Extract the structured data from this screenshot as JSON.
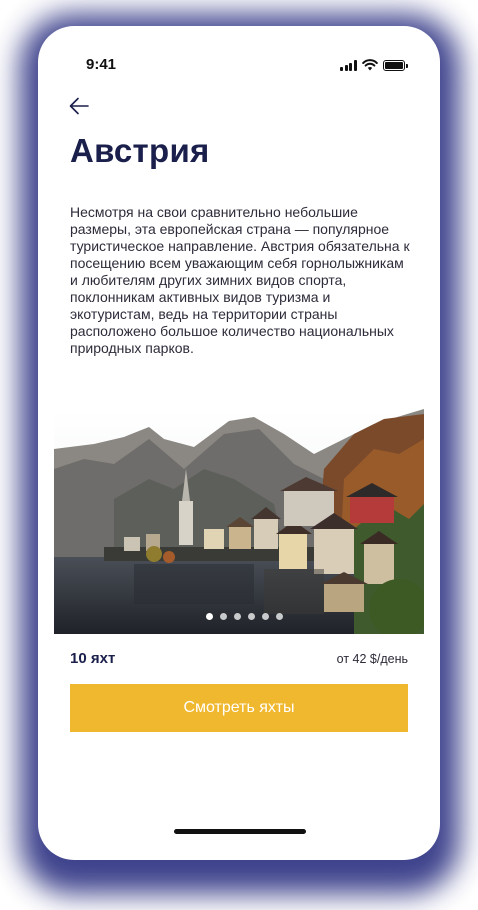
{
  "status_bar": {
    "time": "9:41",
    "icons": [
      "signal-icon",
      "wifi-icon",
      "battery-icon"
    ]
  },
  "header": {
    "back_icon": "arrow-left-icon",
    "title": "Австрия"
  },
  "description": "Несмотря на свои сравнительно небольшие размеры, эта европейская страна — популярное туристическое направление. Австрия обязательна к посещению всем уважающим себя горнолыжникам и любителям других зимних видов спорта, поклонникам активных видов туризма и экотуристам, ведь на территории страны расположено большое количество национальных природных парков.",
  "gallery": {
    "image_subject": "alpine lakeside village with mountains",
    "slide_count": 6,
    "active_slide": 1
  },
  "summary": {
    "yacht_count": "10 яхт",
    "price": "от 42 $/день"
  },
  "cta": {
    "label": "Смотреть яхты"
  },
  "colors": {
    "title": "#1b1f4b",
    "accent": "#f0b82e",
    "frame_shadow": "#2a2f80",
    "text": "#2c2c3a"
  }
}
